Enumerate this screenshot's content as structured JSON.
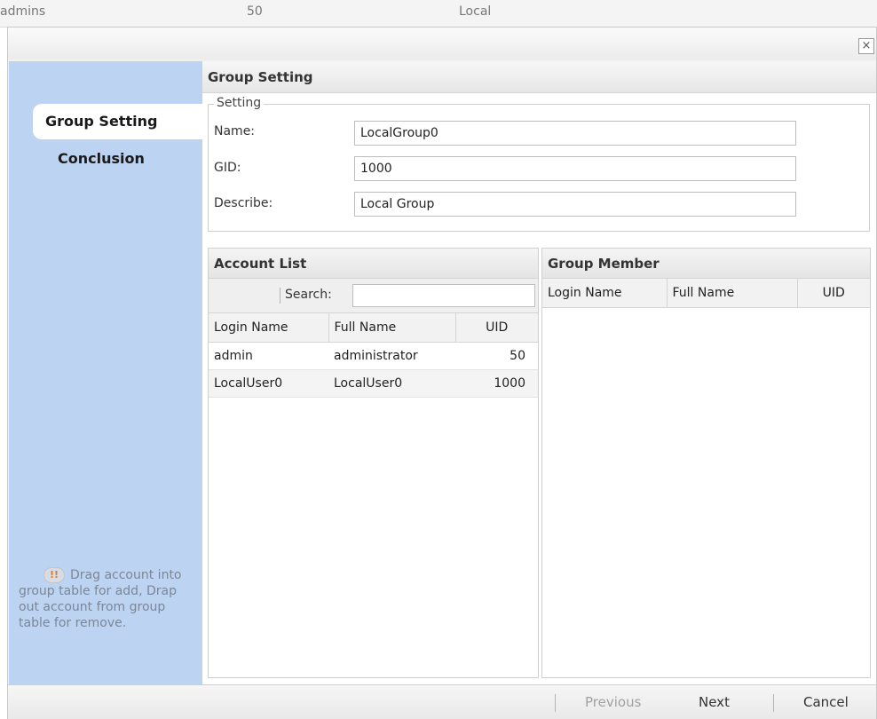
{
  "background_row": {
    "name": "admins",
    "id": "50",
    "type": "Local"
  },
  "close_glyph": "×",
  "sidebar": {
    "items": [
      {
        "label": "Group Setting"
      },
      {
        "label": "Conclusion"
      }
    ],
    "hint_icon": "!!",
    "hint_text": "Drag account into group table for add, Drap out account from group table for remove."
  },
  "main": {
    "header": "Group Setting",
    "setting": {
      "legend": "Setting",
      "name_label": "Name:",
      "name_value": "LocalGroup0",
      "gid_label": "GID:",
      "gid_value": "1000",
      "describe_label": "Describe:",
      "describe_value": "Local Group"
    },
    "account_list": {
      "title": "Account List",
      "search_label": "Search:",
      "columns": [
        "Login Name",
        "Full Name",
        "UID"
      ],
      "rows": [
        {
          "login": "admin",
          "full": "administrator",
          "uid": "50"
        },
        {
          "login": "LocalUser0",
          "full": "LocalUser0",
          "uid": "1000"
        }
      ]
    },
    "group_member": {
      "title": "Group Member",
      "columns": [
        "Login Name",
        "Full Name",
        "UID"
      ]
    }
  },
  "footer": {
    "previous": "Previous",
    "next": "Next",
    "cancel": "Cancel"
  }
}
